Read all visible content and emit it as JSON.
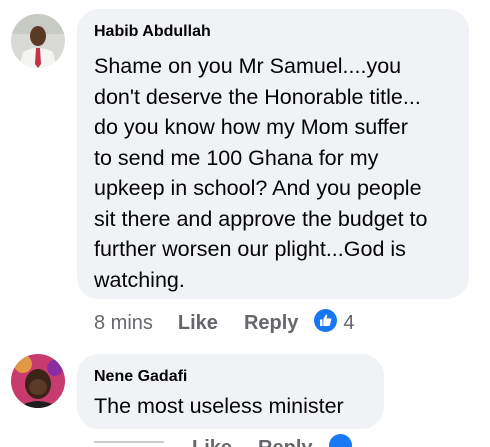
{
  "comments": [
    {
      "author": "Habib Abdullah",
      "text": "Shame on you Mr Samuel....you\ndon't deserve the Honorable title...\ndo you know how my Mom suffer\nto send me 100 Ghana for my\nupkeep in school? And you people\nsit there and approve the budget to\nfurther worsen our plight...God is\nwatching.",
      "time": "8 mins",
      "like_label": "Like",
      "reply_label": "Reply",
      "reaction_icon": "like-reaction-icon",
      "reaction_count": "4"
    },
    {
      "author": "Nene Gadafi",
      "text": "The most useless minister",
      "time": "",
      "like_label": "Like",
      "reply_label": "Reply",
      "reaction_icon": "like-reaction-icon",
      "reaction_count": ""
    }
  ],
  "colors": {
    "bubble": "#f0f2f5",
    "text": "#050505",
    "meta": "#65676b",
    "like_blue": "#1877f2"
  }
}
